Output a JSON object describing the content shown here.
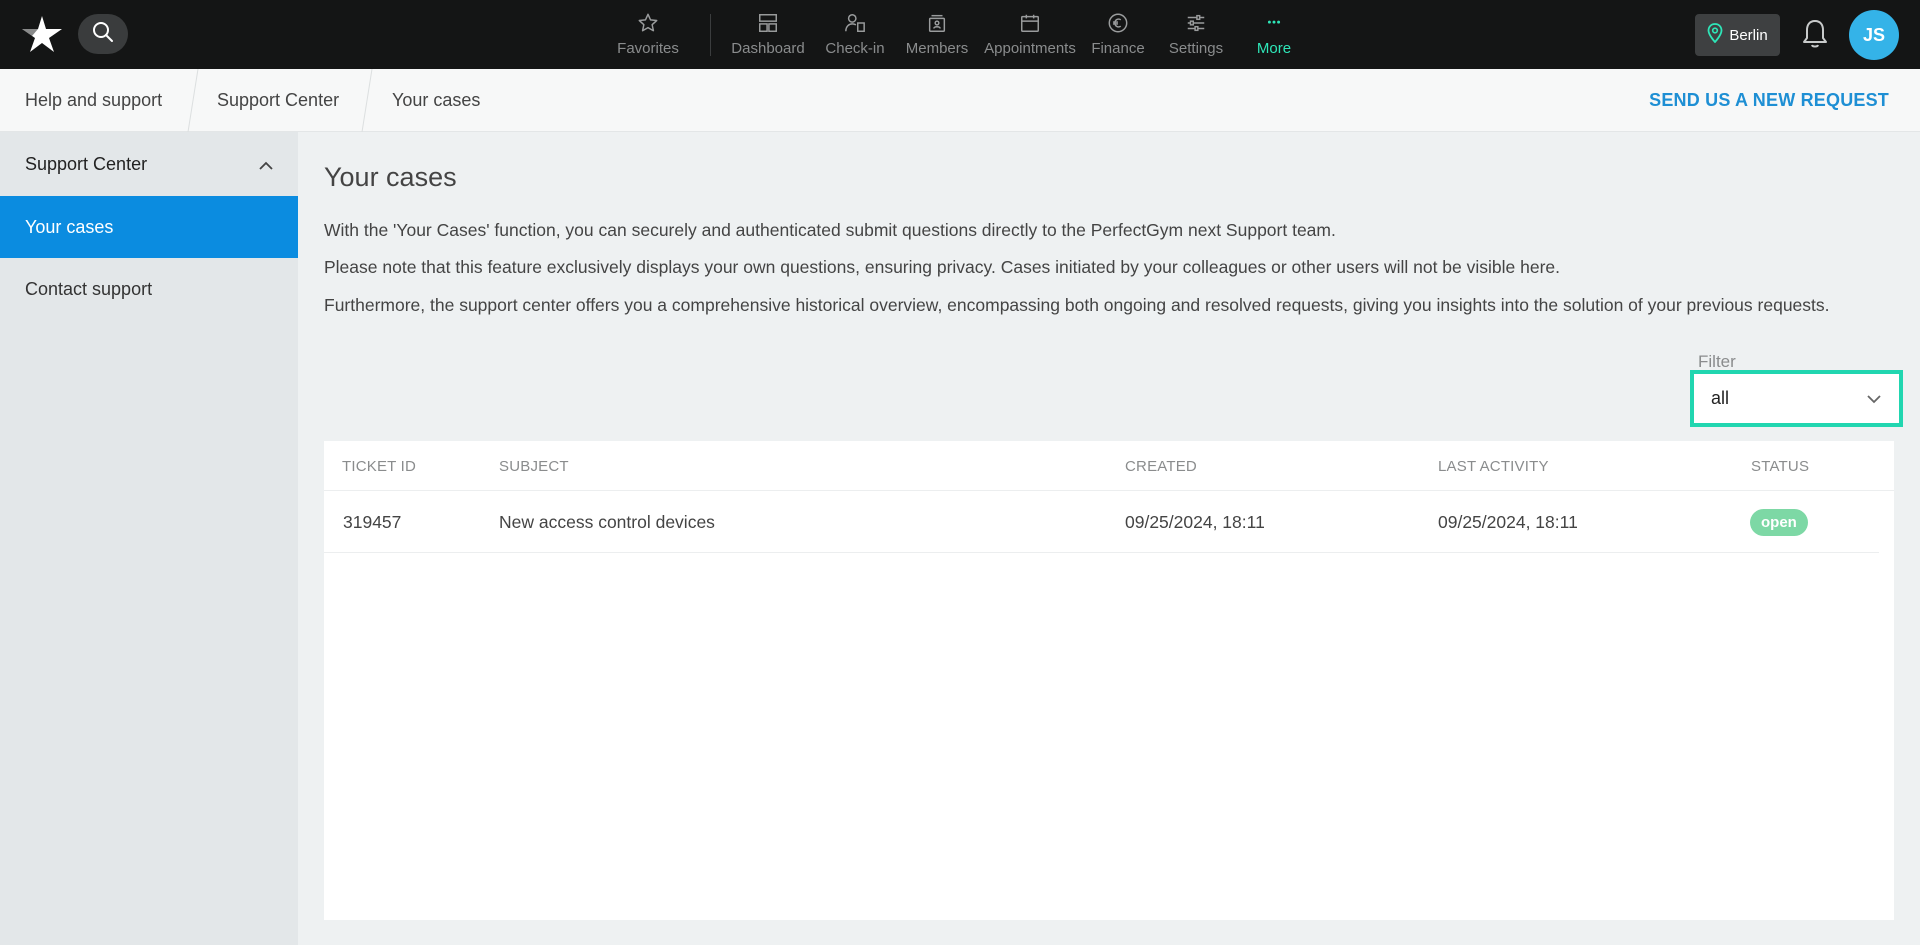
{
  "topbar": {
    "nav": [
      {
        "label": "Favorites",
        "icon": "star-icon"
      },
      {
        "label": "Dashboard",
        "icon": "dashboard-icon"
      },
      {
        "label": "Check-in",
        "icon": "check-in-icon"
      },
      {
        "label": "Members",
        "icon": "members-icon"
      },
      {
        "label": "Appointments",
        "icon": "calendar-icon"
      },
      {
        "label": "Finance",
        "icon": "euro-icon"
      },
      {
        "label": "Settings",
        "icon": "sliders-icon"
      },
      {
        "label": "More",
        "icon": "more-dots-icon"
      }
    ],
    "location": "Berlin",
    "avatar_initials": "JS"
  },
  "breadcrumb": {
    "items": [
      "Help and support",
      "Support Center",
      "Your cases"
    ],
    "action": "SEND US A NEW REQUEST"
  },
  "sidebar": {
    "section": "Support Center",
    "items": [
      {
        "label": "Your cases",
        "active": true
      },
      {
        "label": "Contact support",
        "active": false
      }
    ]
  },
  "main": {
    "title": "Your cases",
    "paragraphs": [
      "With the 'Your Cases' function, you can securely and authenticated submit questions directly to the PerfectGym next Support team.",
      "Please note that this feature exclusively displays your own questions, ensuring privacy. Cases initiated by your colleagues or other users will not be visible here.",
      "Furthermore, the support center offers you a comprehensive historical overview, encompassing both ongoing and resolved requests, giving you insights into the solution of your previous requests."
    ],
    "filter": {
      "label": "Filter",
      "value": "all"
    },
    "table": {
      "columns": [
        "TICKET ID",
        "SUBJECT",
        "CREATED",
        "LAST ACTIVITY",
        "STATUS"
      ],
      "rows": [
        {
          "ticket_id": "319457",
          "subject": "New access control devices",
          "created": "09/25/2024, 18:11",
          "last_activity": "09/25/2024, 18:11",
          "status": "open"
        }
      ]
    }
  },
  "colors": {
    "topbar_bg": "#141515",
    "accent_green": "#2ee6b8",
    "active_blue": "#0b8ce0",
    "link_blue": "#1e8fd4",
    "status_open": "#7dd8a5",
    "avatar_bg": "#34b3e8"
  }
}
